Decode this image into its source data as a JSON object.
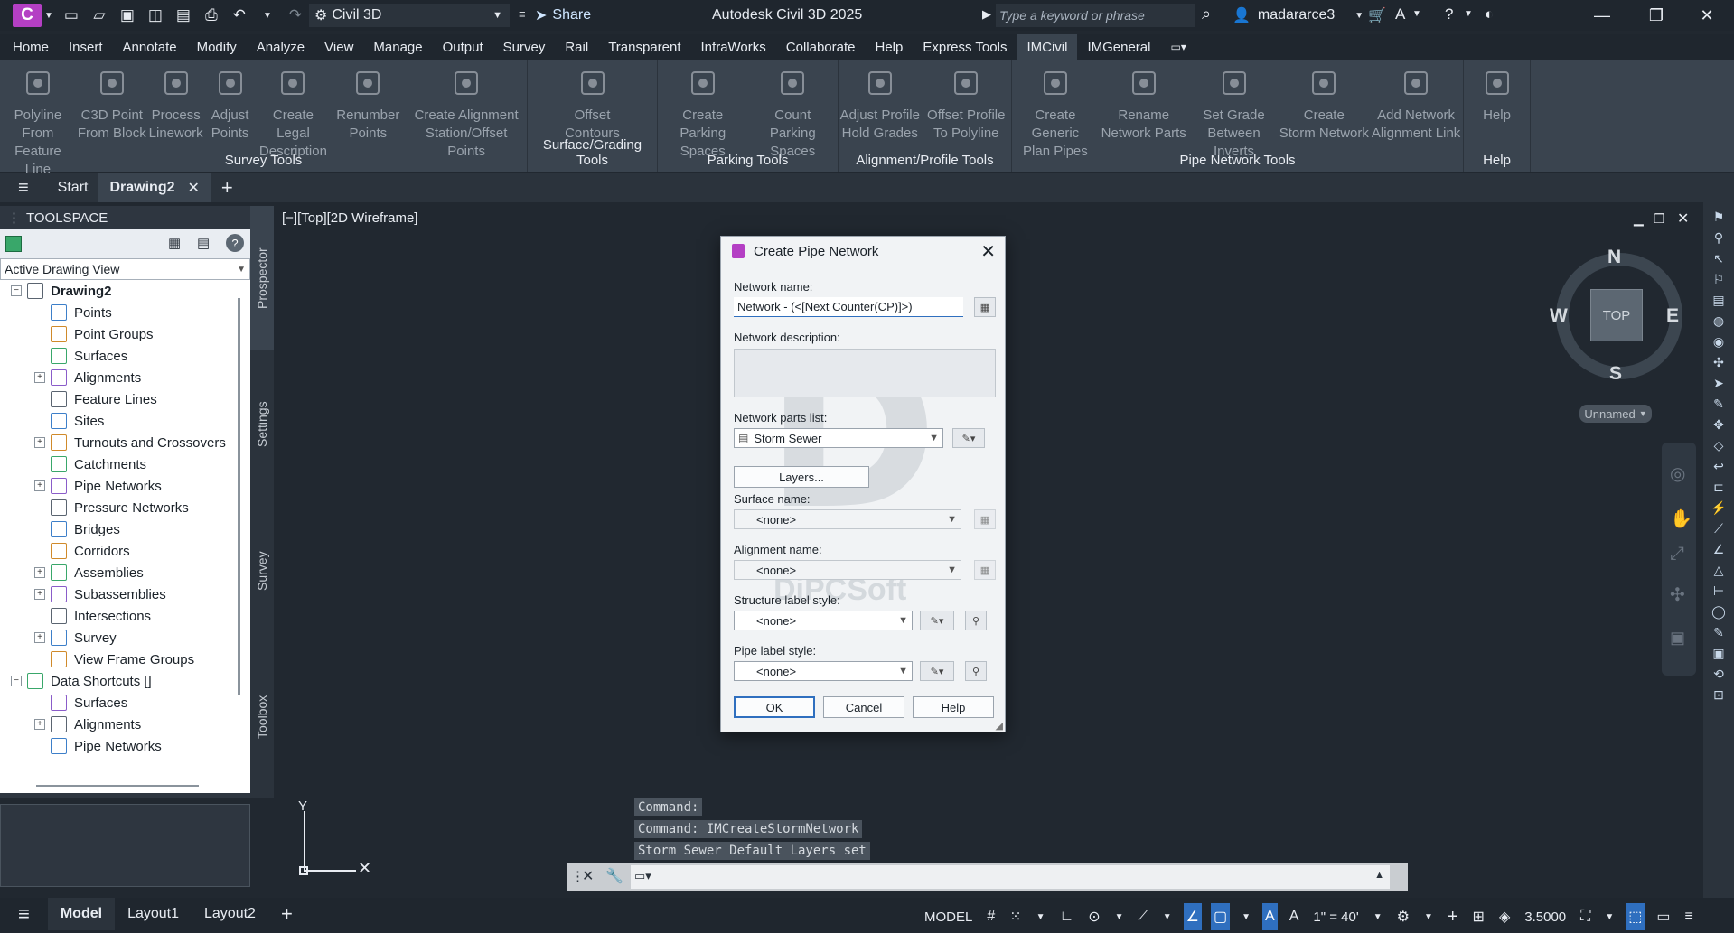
{
  "app": {
    "title": "Autodesk Civil 3D 2025",
    "logo_letter": "C",
    "workspace": "Civil 3D",
    "share_label": "Share",
    "search_placeholder": "Type a keyword or phrase",
    "user": "madararce3"
  },
  "menubar": {
    "items": [
      "Home",
      "Insert",
      "Annotate",
      "Modify",
      "Analyze",
      "View",
      "Manage",
      "Output",
      "Survey",
      "Rail",
      "Transparent",
      "InfraWorks",
      "Collaborate",
      "Help",
      "Express Tools",
      "IMCivil",
      "IMGeneral"
    ],
    "active": "IMCivil"
  },
  "ribbon": {
    "panels": [
      {
        "title": "Survey Tools",
        "tools": [
          {
            "label": [
              "Polyline",
              "From Feature Line"
            ],
            "icon": "polyline-icon"
          },
          {
            "label": [
              "C3D Point",
              "From Block"
            ],
            "icon": "point-block-icon"
          },
          {
            "label": [
              "Process",
              "Linework"
            ],
            "icon": "linework-icon"
          },
          {
            "label": [
              "Adjust",
              "Points"
            ],
            "icon": "adjust-points-icon"
          },
          {
            "label": [
              "Create Legal",
              "Description"
            ],
            "icon": "legal-description-icon"
          },
          {
            "label": [
              "Renumber",
              "Points"
            ],
            "icon": "renumber-icon"
          },
          {
            "label": [
              "Create Alignment",
              "Station/Offset Points"
            ],
            "icon": "alignment-points-icon"
          }
        ]
      },
      {
        "title": "Surface/Grading Tools",
        "tools": [
          {
            "label": [
              "Offset",
              "Contours"
            ],
            "icon": "offset-contours-icon"
          }
        ]
      },
      {
        "title": "Parking Tools",
        "tools": [
          {
            "label": [
              "Create",
              "Parking Spaces"
            ],
            "icon": "parking-create-icon"
          },
          {
            "label": [
              "Count",
              "Parking Spaces"
            ],
            "icon": "parking-count-icon"
          }
        ]
      },
      {
        "title": "Alignment/Profile Tools",
        "tools": [
          {
            "label": [
              "Adjust Profile",
              "Hold Grades"
            ],
            "icon": "profile-grades-icon"
          },
          {
            "label": [
              "Offset Profile",
              "To Polyline"
            ],
            "icon": "profile-polyline-icon"
          }
        ]
      },
      {
        "title": "Pipe Network Tools",
        "tools": [
          {
            "label": [
              "Create Generic",
              "Plan Pipes"
            ],
            "icon": "generic-pipes-icon"
          },
          {
            "label": [
              "Rename",
              "Network Parts"
            ],
            "icon": "rename-parts-icon"
          },
          {
            "label": [
              "Set Grade",
              "Between Inverts"
            ],
            "icon": "grade-inverts-icon"
          },
          {
            "label": [
              "Create",
              "Storm Network"
            ],
            "icon": "storm-network-icon"
          },
          {
            "label": [
              "Add Network",
              "Alignment Link"
            ],
            "icon": "alignment-link-icon"
          }
        ]
      },
      {
        "title": "Help",
        "tools": [
          {
            "label": [
              "Help",
              ""
            ],
            "icon": "help-icon"
          }
        ]
      }
    ]
  },
  "doctabs": {
    "start": "Start",
    "active": "Drawing2"
  },
  "toolspace": {
    "title": "TOOLSPACE",
    "view": "Active Drawing View",
    "vtabs": [
      "Prospector",
      "Settings",
      "Survey",
      "Toolbox"
    ],
    "tree": [
      {
        "label": "Drawing2",
        "level": 0,
        "exp": "-",
        "bold": true
      },
      {
        "label": "Points",
        "level": 1,
        "exp": ""
      },
      {
        "label": "Point Groups",
        "level": 1,
        "exp": ""
      },
      {
        "label": "Surfaces",
        "level": 1,
        "exp": ""
      },
      {
        "label": "Alignments",
        "level": 1,
        "exp": "+"
      },
      {
        "label": "Feature Lines",
        "level": 1,
        "exp": ""
      },
      {
        "label": "Sites",
        "level": 1,
        "exp": ""
      },
      {
        "label": "Turnouts and Crossovers",
        "level": 1,
        "exp": "+"
      },
      {
        "label": "Catchments",
        "level": 1,
        "exp": ""
      },
      {
        "label": "Pipe Networks",
        "level": 1,
        "exp": "+"
      },
      {
        "label": "Pressure Networks",
        "level": 1,
        "exp": ""
      },
      {
        "label": "Bridges",
        "level": 1,
        "exp": ""
      },
      {
        "label": "Corridors",
        "level": 1,
        "exp": ""
      },
      {
        "label": "Assemblies",
        "level": 1,
        "exp": "+"
      },
      {
        "label": "Subassemblies",
        "level": 1,
        "exp": "+"
      },
      {
        "label": "Intersections",
        "level": 1,
        "exp": ""
      },
      {
        "label": "Survey",
        "level": 1,
        "exp": "+"
      },
      {
        "label": "View Frame Groups",
        "level": 1,
        "exp": ""
      },
      {
        "label": "Data Shortcuts []",
        "level": 0,
        "exp": "-"
      },
      {
        "label": "Surfaces",
        "level": 1,
        "exp": ""
      },
      {
        "label": "Alignments",
        "level": 1,
        "exp": "+"
      },
      {
        "label": "Pipe Networks",
        "level": 1,
        "exp": ""
      }
    ]
  },
  "viewport": {
    "label": "[−][Top][2D Wireframe]"
  },
  "viewcube": {
    "n": "N",
    "s": "S",
    "e": "E",
    "w": "W",
    "top": "TOP",
    "ucs": "Unnamed"
  },
  "command": {
    "lines": [
      "Command:",
      "Command: IMCreateStormNetwork",
      "Storm Sewer Default Layers set"
    ]
  },
  "statusbar": {
    "tabs": [
      "Model",
      "Layout1",
      "Layout2"
    ],
    "active": "Model",
    "model": "MODEL",
    "scale": "1\" = 40'",
    "value": "3.5000"
  },
  "dialog": {
    "title": "Create Pipe Network",
    "network_name_label": "Network name:",
    "network_name": "Network - (<[Next Counter(CP)]>)",
    "description_label": "Network description:",
    "parts_list_label": "Network parts list:",
    "parts_list": "Storm Sewer",
    "layers_button": "Layers...",
    "surface_label": "Surface name:",
    "surface": "<none>",
    "alignment_label": "Alignment name:",
    "alignment": "<none>",
    "structure_label": "Structure label style:",
    "structure_style": "<none>",
    "pipe_label": "Pipe label style:",
    "pipe_style": "<none>",
    "ok": "OK",
    "cancel": "Cancel",
    "help": "Help",
    "watermark": "D",
    "watermark_text": "DiPCSoft"
  }
}
